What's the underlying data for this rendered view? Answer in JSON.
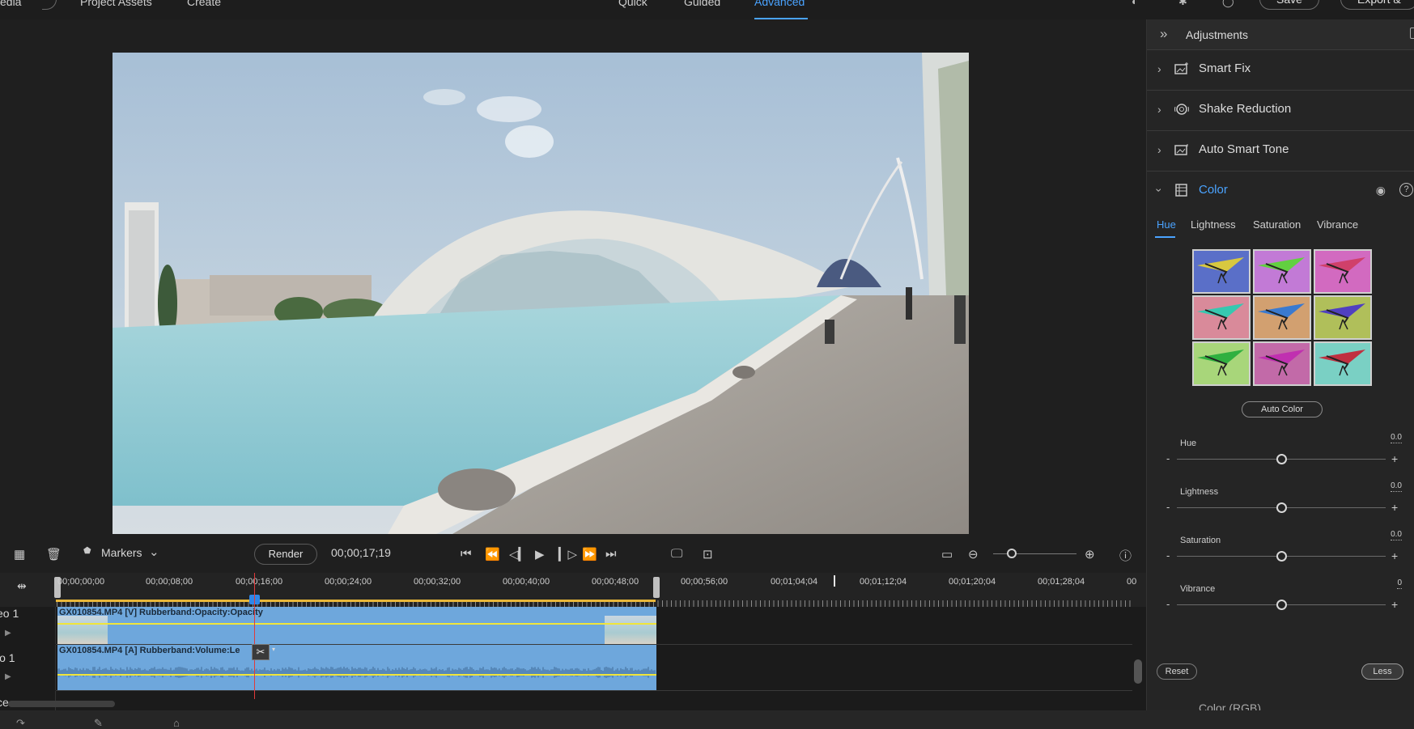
{
  "topbar": {
    "left_partial": "edia",
    "project_assets": "Project Assets",
    "create": "Create",
    "modes": [
      "Quick",
      "Guided",
      "Advanced"
    ],
    "save": "Save",
    "export": "Export &"
  },
  "adjustments": {
    "title": "Adjustments",
    "sections": [
      {
        "label": "Smart Fix",
        "icon": "smart-fix-icon"
      },
      {
        "label": "Shake Reduction",
        "icon": "shake-reduction-icon"
      },
      {
        "label": "Auto Smart Tone",
        "icon": "auto-smart-tone-icon"
      }
    ],
    "color": {
      "label": "Color",
      "tabs": [
        "Hue",
        "Lightness",
        "Saturation",
        "Vibrance"
      ],
      "auto_color": "Auto Color",
      "sliders": [
        {
          "label": "Hue",
          "value": "0.0",
          "position": 0.5
        },
        {
          "label": "Lightness",
          "value": "0.0",
          "position": 0.5
        },
        {
          "label": "Saturation",
          "value": "0.0",
          "position": 0.5
        },
        {
          "label": "Vibrance",
          "value": "0",
          "position": 0.5
        }
      ],
      "minus": "-",
      "plus": "+",
      "reset": "Reset",
      "less": "Less"
    },
    "next_section_partial": "Color (RGB)"
  },
  "toolbar": {
    "markers": "Markers",
    "render": "Render",
    "timecode": "00;00;17;19",
    "zoom_level": 0.22
  },
  "ruler": {
    "labels": [
      "00;00;00;00",
      "00;00;08;00",
      "00;00;16;00",
      "00;00;24;00",
      "00;00;32;00",
      "00;00;40;00",
      "00;00;48;00",
      "00;00;56;00",
      "00;01;04;04",
      "00;01;12;04",
      "00;01;20;04",
      "00;01;28;04",
      "00"
    ]
  },
  "tracks": {
    "video": {
      "name": "eo 1",
      "clip": "GX010854.MP4 [V] Rubberband:Opacity:Opacity"
    },
    "audio": {
      "name": "io 1",
      "clip": "GX010854.MP4 [A] Rubberband:Volume:Le"
    },
    "third_partial": "ce"
  },
  "colors": {
    "accent": "#4aa3ff",
    "clip": "#6ea7dc",
    "rubberband": "#f0e53a",
    "playhead": "#e03a3a"
  }
}
